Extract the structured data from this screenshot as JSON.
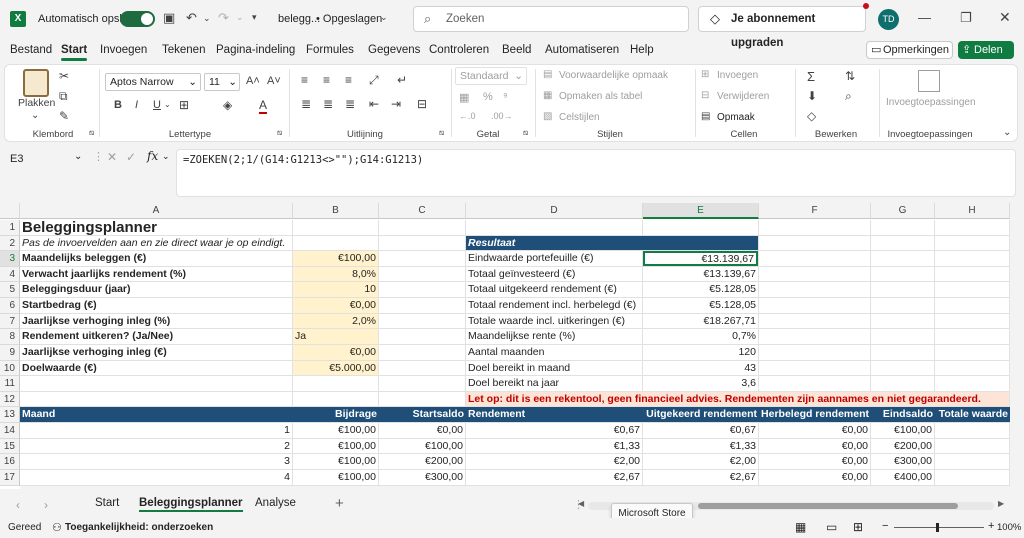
{
  "titlebar": {
    "logo_letter": "X",
    "autosave_label": "Automatisch opslaan",
    "filename": "belegg...",
    "saved_state": "• Opgeslagen",
    "search_placeholder": "Zoeken",
    "upgrade_label": "Je abonnement upgraden",
    "avatar_initials": "TD"
  },
  "ribbon_tabs": [
    "Bestand",
    "Start",
    "Invoegen",
    "Tekenen",
    "Pagina-indeling",
    "Formules",
    "Gegevens",
    "Controleren",
    "Beeld",
    "Automatiseren",
    "Help"
  ],
  "active_tab": "Start",
  "comments_label": "Opmerkingen",
  "share_label": "Delen",
  "ribbon": {
    "paste_label": "Plakken",
    "font_name": "Aptos Narrow",
    "font_size": "11",
    "number_format": "Standaard",
    "cond_format": "Voorwaardelijke opmaak",
    "format_table": "Opmaken als tabel",
    "cell_styles": "Celstijlen",
    "insert": "Invoegen",
    "delete": "Verwijderen",
    "format": "Opmaak",
    "addins": "Invoegtoepassingen",
    "groups": {
      "clipboard": "Klembord",
      "font": "Lettertype",
      "alignment": "Uitlijning",
      "number": "Getal",
      "styles": "Stijlen",
      "cells": "Cellen",
      "editing": "Bewerken",
      "addins": "Invoegtoepassingen"
    }
  },
  "formula_bar": {
    "name_box": "E3",
    "fx": "fx",
    "formula": "=ZOEKEN(2;1/(G14:G1213<>\"\");G14:G1213)"
  },
  "columns": [
    "A",
    "B",
    "C",
    "D",
    "E",
    "F",
    "G",
    "H"
  ],
  "rows": {
    "r1": {
      "A": "Beleggingsplanner"
    },
    "r2": {
      "A": "Pas de invoervelden aan en zie direct waar je op eindigt.",
      "D": "Resultaat"
    },
    "r3": {
      "A": "Maandelijks beleggen (€)",
      "B": "€100,00",
      "D": "Eindwaarde portefeuille (€)",
      "E": "€13.139,67"
    },
    "r4": {
      "A": "Verwacht jaarlijks rendement (%)",
      "B": "8,0%",
      "D": "Totaal geïnvesteerd (€)",
      "E": "€13.139,67"
    },
    "r5": {
      "A": "Beleggingsduur (jaar)",
      "B": "10",
      "D": "Totaal uitgekeerd rendement (€)",
      "E": "€5.128,05"
    },
    "r6": {
      "A": "Startbedrag (€)",
      "B": "€0,00",
      "D": "Totaal rendement incl. herbelegd (€)",
      "E": "€5.128,05"
    },
    "r7": {
      "A": "Jaarlijkse verhoging inleg (%)",
      "B": "2,0%",
      "D": "Totale waarde incl. uitkeringen (€)",
      "E": "€18.267,71"
    },
    "r8": {
      "A": "Rendement uitkeren? (Ja/Nee)",
      "B": "Ja",
      "D": "Maandelijkse rente (%)",
      "E": "0,7%"
    },
    "r9": {
      "A": "Jaarlijkse verhoging inleg (€)",
      "B": "€0,00",
      "D": "Aantal maanden",
      "E": "120"
    },
    "r10": {
      "A": "Doelwaarde (€)",
      "B": "€5.000,00",
      "D": "Doel bereikt in maand",
      "E": "43"
    },
    "r11": {
      "D": "Doel bereikt na jaar",
      "E": "3,6"
    },
    "r12": {
      "D": "Let op: dit is een rekentool, geen financieel advies. Rendementen zijn aannames en niet gegarandeerd."
    }
  },
  "table_headers": [
    "Maand",
    "Bijdrage",
    "Startsaldo",
    "Rendement",
    "Uitgekeerd rendement",
    "Herbelegd rendement",
    "Eindsaldo",
    "Totale waarde"
  ],
  "table_rows": [
    [
      "1",
      "€100,00",
      "€0,00",
      "€0,67",
      "€0,67",
      "€0,00",
      "€100,00"
    ],
    [
      "2",
      "€100,00",
      "€100,00",
      "€1,33",
      "€1,33",
      "€0,00",
      "€200,00"
    ],
    [
      "3",
      "€100,00",
      "€200,00",
      "€2,00",
      "€2,00",
      "€0,00",
      "€300,00"
    ],
    [
      "4",
      "€100,00",
      "€300,00",
      "€2,67",
      "€2,67",
      "€0,00",
      "€400,00"
    ]
  ],
  "row_numbers": [
    "1",
    "2",
    "3",
    "4",
    "5",
    "6",
    "7",
    "8",
    "9",
    "10",
    "11",
    "12",
    "13",
    "14",
    "15",
    "16",
    "17"
  ],
  "sheets": [
    "Start",
    "Beleggingsplanner",
    "Analyse"
  ],
  "active_sheet": "Beleggingsplanner",
  "tooltip": "Microsoft Store",
  "status": {
    "ready": "Gereed",
    "accessibility": "Toegankelijkheid: onderzoeken",
    "zoom": "100%"
  }
}
